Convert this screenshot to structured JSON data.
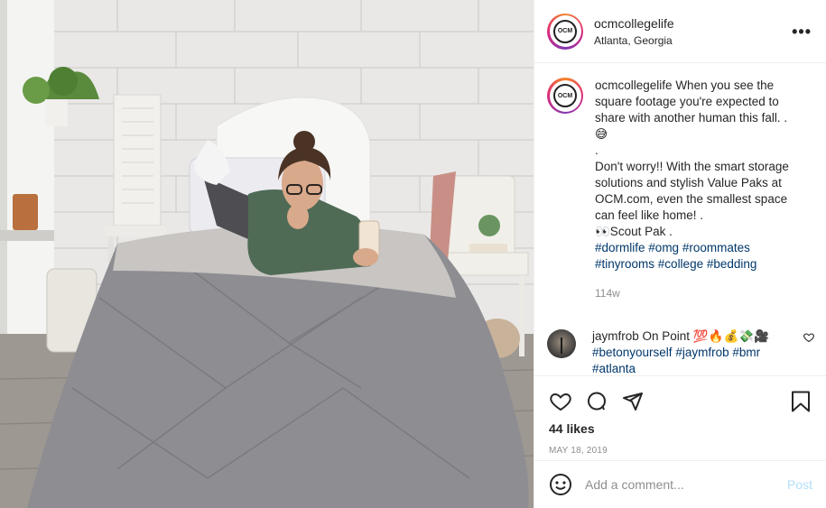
{
  "post": {
    "username": "ocmcollegelife",
    "location": "Atlanta, Georgia",
    "more_label": "•••",
    "avatar_text": "OCM",
    "caption": {
      "username": "ocmcollegelife",
      "line1": "When you see the square footage you're expected to share with another human this fall. .",
      "emoji1": "😅",
      "dot": ".",
      "line2": "Don't worry!! With the smart storage solutions and stylish Value Paks at OCM.com, even the smallest space can feel like home! .",
      "line3": "👀Scout Pak .",
      "hashtags": [
        "#dormlife",
        "#omg",
        "#roommates",
        "#tinyrooms",
        "#college",
        "#bedding"
      ]
    },
    "caption_age": "114w",
    "reply": {
      "username": "jaymfrob",
      "text": "On Point",
      "emojis": "💯🔥💰💸🎥",
      "hashtags": [
        "#betonyourself",
        "#jaymfrob",
        "#bmr",
        "#atlanta"
      ]
    },
    "likes": "44 likes",
    "date": "MAY 18, 2019",
    "comment_placeholder": "Add a comment...",
    "post_button": "Post"
  }
}
